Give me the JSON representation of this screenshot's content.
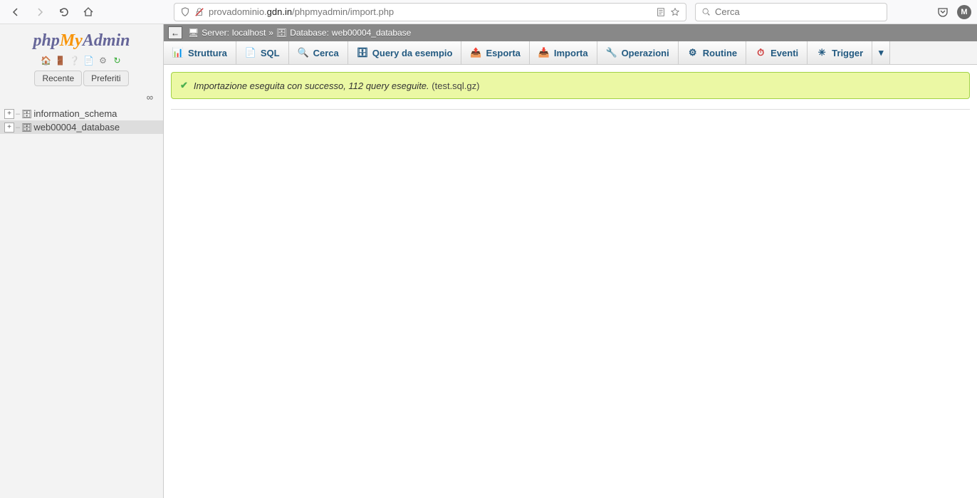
{
  "browser": {
    "url_prefix": "provadominio.",
    "url_bold": "gdn.in",
    "url_suffix": "/phpmyadmin/import.php",
    "search_placeholder": "Cerca",
    "avatar_letter": "M"
  },
  "logo": {
    "p1": "php",
    "p2": "My",
    "p3": "Admin"
  },
  "sidebar": {
    "tabs": {
      "recent": "Recente",
      "favorites": "Preferiti"
    },
    "items": [
      {
        "name": "information_schema",
        "selected": false
      },
      {
        "name": "web00004_database",
        "selected": true
      }
    ]
  },
  "breadcrumb": {
    "server_label": "Server:",
    "server_value": "localhost",
    "sep": "»",
    "db_label": "Database:",
    "db_value": "web00004_database"
  },
  "tabs": [
    {
      "label": "Struttura",
      "icon": "📊",
      "color": "#235a81"
    },
    {
      "label": "SQL",
      "icon": "📄",
      "color": "#235a81"
    },
    {
      "label": "Cerca",
      "icon": "🔍",
      "color": "#235a81"
    },
    {
      "label": "Query da esempio",
      "icon": "🗄",
      "color": "#235a81"
    },
    {
      "label": "Esporta",
      "icon": "📤",
      "color": "#235a81"
    },
    {
      "label": "Importa",
      "icon": "📥",
      "color": "#235a81"
    },
    {
      "label": "Operazioni",
      "icon": "🔧",
      "color": "#235a81"
    },
    {
      "label": "Routine",
      "icon": "⚙",
      "color": "#235a81"
    },
    {
      "label": "Eventi",
      "icon": "⏱",
      "color": "#235a81"
    },
    {
      "label": "Trigger",
      "icon": "✳",
      "color": "#235a81"
    }
  ],
  "notice": {
    "message": "Importazione eseguita con successo, 112 query eseguite.",
    "file": "(test.sql.gz)"
  }
}
